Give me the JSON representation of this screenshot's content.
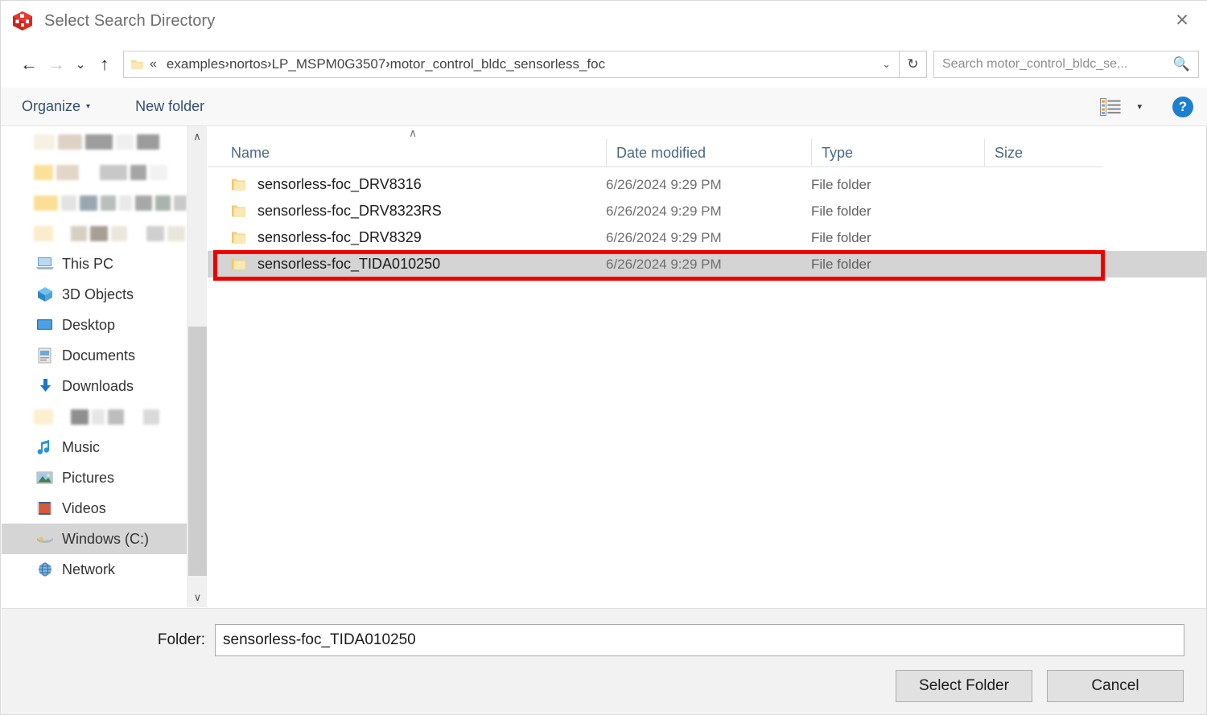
{
  "window": {
    "title": "Select Search Directory",
    "app_icon": "package-cube-icon",
    "close_label": "✕"
  },
  "nav": {
    "back": "←",
    "forward": "→",
    "recent": "⌄",
    "up": "↑",
    "address_overflow": "«",
    "breadcrumbs": [
      "examples",
      "nortos",
      "LP_MSPM0G3507",
      "motor_control_bldc_sensorless_foc"
    ],
    "separator": "›",
    "dropdown": "⌄",
    "refresh": "↻"
  },
  "search": {
    "placeholder": "Search motor_control_bldc_se...",
    "value": "",
    "icon": "search-icon"
  },
  "toolbar": {
    "organize_label": "Organize",
    "organize_caret": "▾",
    "new_folder_label": "New folder",
    "view_caret": "▾",
    "help_label": "?"
  },
  "sidebar": {
    "scroll_up": "∧",
    "scroll_down": "∨",
    "items": [
      {
        "type": "redacted",
        "blocks": [
          [
            26,
            "#f6f1e0"
          ],
          [
            30,
            "#ded2c6"
          ],
          [
            34,
            "#9d9d9d"
          ],
          [
            22,
            "#efefef"
          ],
          [
            28,
            "#9c9c9c"
          ]
        ]
      },
      {
        "type": "redacted",
        "blocks": [
          [
            24,
            "#fbe09a"
          ],
          [
            28,
            "#e2d6c9"
          ],
          [
            18,
            "#ffffff"
          ],
          [
            34,
            "#c8c8c8"
          ],
          [
            20,
            "#a5a5a5"
          ],
          [
            22,
            "#f2f2f2"
          ]
        ]
      },
      {
        "type": "redacted",
        "blocks": [
          [
            42,
            "#fbdf96"
          ],
          [
            26,
            "#e3e3e3"
          ],
          [
            30,
            "#9aa7b3"
          ],
          [
            26,
            "#b9bfbb"
          ],
          [
            22,
            "#e9e9e9"
          ],
          [
            30,
            "#a8a8a8"
          ],
          [
            26,
            "#aab3ae"
          ],
          [
            22,
            "#c9c9c9"
          ]
        ]
      },
      {
        "type": "redacted",
        "blocks": [
          [
            24,
            "#fbeccb"
          ],
          [
            14,
            "#ffffff"
          ],
          [
            20,
            "#d6cfc2"
          ],
          [
            22,
            "#a79e94"
          ],
          [
            20,
            "#ebe7dd"
          ],
          [
            16,
            "#ffffff"
          ],
          [
            22,
            "#cfcfcf"
          ],
          [
            22,
            "#e9e7dc"
          ]
        ]
      },
      {
        "type": "item",
        "label": "This PC",
        "icon": "computer-icon"
      },
      {
        "type": "item",
        "label": "3D Objects",
        "icon": "cube-3d-icon"
      },
      {
        "type": "item",
        "label": "Desktop",
        "icon": "desktop-icon"
      },
      {
        "type": "item",
        "label": "Documents",
        "icon": "documents-icon"
      },
      {
        "type": "item",
        "label": "Downloads",
        "icon": "download-arrow-icon"
      },
      {
        "type": "redacted",
        "blocks": [
          [
            24,
            "#fcefd0"
          ],
          [
            14,
            "#ffffff"
          ],
          [
            22,
            "#8f8f8f"
          ],
          [
            16,
            "#e6e6e6"
          ],
          [
            20,
            "#bdbdbd"
          ],
          [
            16,
            "#ffffff"
          ],
          [
            20,
            "#d9d9d9"
          ]
        ]
      },
      {
        "type": "item",
        "label": "Music",
        "icon": "music-note-icon"
      },
      {
        "type": "item",
        "label": "Pictures",
        "icon": "pictures-icon"
      },
      {
        "type": "item",
        "label": "Videos",
        "icon": "videos-icon"
      },
      {
        "type": "item",
        "label": "Windows (C:)",
        "icon": "hard-drive-icon",
        "selected": true
      },
      {
        "type": "item",
        "label": "Network",
        "icon": "network-icon"
      }
    ]
  },
  "filelist": {
    "sort_indicator": "∧",
    "columns": [
      "Name",
      "Date modified",
      "Type",
      "Size"
    ],
    "rows": [
      {
        "name": "sensorless-foc_DRV8316",
        "date": "6/26/2024 9:29 PM",
        "type": "File folder",
        "size": ""
      },
      {
        "name": "sensorless-foc_DRV8323RS",
        "date": "6/26/2024 9:29 PM",
        "type": "File folder",
        "size": ""
      },
      {
        "name": "sensorless-foc_DRV8329",
        "date": "6/26/2024 9:29 PM",
        "type": "File folder",
        "size": ""
      },
      {
        "name": "sensorless-foc_TIDA010250",
        "date": "6/26/2024 9:29 PM",
        "type": "File folder",
        "size": "",
        "selected": true
      }
    ]
  },
  "annotation": {
    "color": "#ef0000"
  },
  "footer": {
    "folder_label": "Folder:",
    "folder_value": "sensorless-foc_TIDA010250",
    "select_button": "Select Folder",
    "cancel_button": "Cancel"
  },
  "colors": {
    "accent_blue": "#1d7fd0",
    "header_text": "#4a6783",
    "selection_gray": "#d4d4d4",
    "annotation_red": "#ef0000",
    "folder_yellow": "#f6d97a"
  }
}
